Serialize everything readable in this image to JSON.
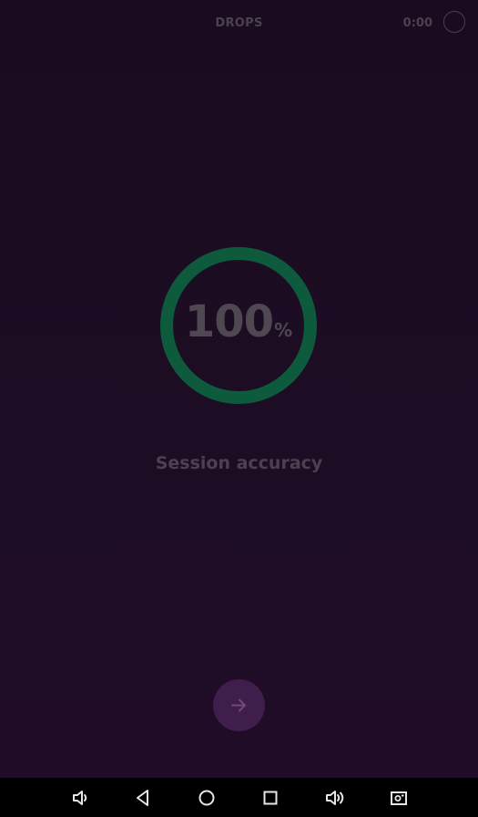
{
  "app": {
    "title": "DROPS",
    "timer": "0:00"
  },
  "result": {
    "accuracy_value": "100",
    "accuracy_unit": "%",
    "accuracy_fraction": 1.0,
    "label": "Session accuracy"
  },
  "next_button": {
    "icon": "arrow-right-icon"
  },
  "nav_bar": {
    "items": [
      {
        "icon": "volume-down-icon"
      },
      {
        "icon": "back-icon"
      },
      {
        "icon": "home-icon"
      },
      {
        "icon": "recents-icon"
      },
      {
        "icon": "volume-up-icon"
      },
      {
        "icon": "screenshot-icon"
      }
    ]
  },
  "colors": {
    "background": "#1b0d22",
    "ring": "#0d5a3c",
    "text_muted": "#4c4150",
    "next_button": "#3f1e4b",
    "nav_bar": "#000000"
  }
}
